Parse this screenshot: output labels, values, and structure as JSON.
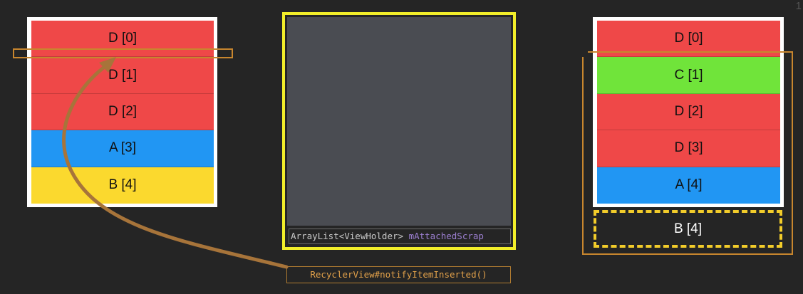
{
  "left_list": {
    "rows": [
      {
        "label": "D [0]",
        "color": "#ef4848"
      },
      {
        "label": "D [1]",
        "color": "#ef4848"
      },
      {
        "label": "D [2]",
        "color": "#ef4848"
      },
      {
        "label": "A [3]",
        "color": "#2196f3"
      },
      {
        "label": "B [4]",
        "color": "#fbd92e"
      }
    ]
  },
  "right_list": {
    "rows": [
      {
        "label": "D [0]",
        "color": "#ef4848"
      },
      {
        "label": "C [1]",
        "color": "#70e43a"
      },
      {
        "label": "D [2]",
        "color": "#ef4848"
      },
      {
        "label": "D [3]",
        "color": "#ef4848"
      },
      {
        "label": "A [4]",
        "color": "#2196f3"
      }
    ],
    "overflow_item": "B [4]"
  },
  "scrap": {
    "type_label": "ArrayList<ViewHolder>",
    "field_label": "mAttachedScrap"
  },
  "notify_call": "RecyclerView#notifyItemInserted()",
  "page_number": "1",
  "colors": {
    "scrap_border": "#f2ee2a",
    "arrow": "#a7743a",
    "highlight_outline": "#c8862e"
  }
}
